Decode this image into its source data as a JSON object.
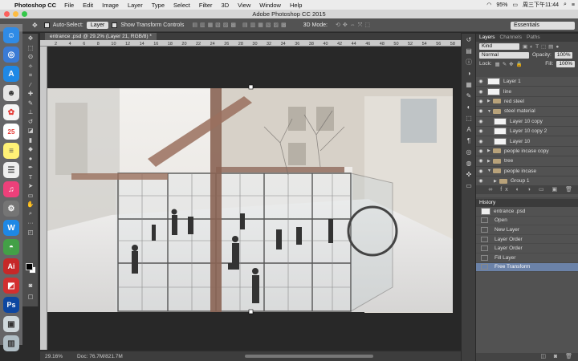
{
  "menubar": {
    "app": "Photoshop CC",
    "items": [
      "File",
      "Edit",
      "Image",
      "Layer",
      "Type",
      "Select",
      "Filter",
      "3D",
      "View",
      "Window",
      "Help"
    ],
    "battery": "95%",
    "clock": "周三下午11:44"
  },
  "window": {
    "title": "Adobe Photoshop CC 2015"
  },
  "options": {
    "auto_select_label": "Auto-Select:",
    "auto_select_value": "Layer",
    "show_transform_label": "Show Transform Controls",
    "mode_3d_label": "3D Mode:",
    "workspace": "Essentials"
  },
  "document": {
    "tab_title": "entrance .psd @ 29.2% (Layer 21, RGB/8) *",
    "zoom": "29.16%",
    "doc_size": "Doc: 76.7M/821.7M",
    "ruler_marks": [
      "2",
      "4",
      "6",
      "8",
      "10",
      "12",
      "14",
      "16",
      "18",
      "20",
      "22",
      "24",
      "26",
      "28",
      "30",
      "32",
      "34",
      "36",
      "38",
      "40",
      "42",
      "44",
      "46",
      "48",
      "50",
      "52",
      "54",
      "56",
      "58"
    ]
  },
  "layers_panel": {
    "tabs": [
      "Layers",
      "Channels",
      "Paths"
    ],
    "filter_kind": "Kind",
    "blend_mode": "Normal",
    "opacity_label": "Opacity:",
    "opacity": "100%",
    "lock_label": "Lock:",
    "fill_label": "Fill:",
    "fill": "100%",
    "layers": [
      {
        "name": "Layer 1",
        "type": "layer",
        "indent": 0
      },
      {
        "name": "line",
        "type": "layer",
        "indent": 0
      },
      {
        "name": "red steel",
        "type": "group",
        "indent": 0,
        "open": false
      },
      {
        "name": "steel material",
        "type": "group",
        "indent": 0,
        "open": true
      },
      {
        "name": "Layer 10 copy",
        "type": "layer",
        "indent": 1
      },
      {
        "name": "Layer 10 copy 2",
        "type": "layer",
        "indent": 1
      },
      {
        "name": "Layer 10",
        "type": "layer",
        "indent": 1
      },
      {
        "name": "people incase copy",
        "type": "group",
        "indent": 0,
        "open": false
      },
      {
        "name": "tree",
        "type": "group",
        "indent": 0,
        "open": false
      },
      {
        "name": "people incase",
        "type": "group",
        "indent": 0,
        "open": true
      },
      {
        "name": "Group 1",
        "type": "group",
        "indent": 1,
        "open": false
      }
    ]
  },
  "history_panel": {
    "title": "History",
    "snapshot": "entrance .psd",
    "states": [
      "Open",
      "New Layer",
      "Layer Order",
      "Layer Order",
      "Fill Layer",
      "Free Transform"
    ],
    "selected": "Free Transform"
  }
}
